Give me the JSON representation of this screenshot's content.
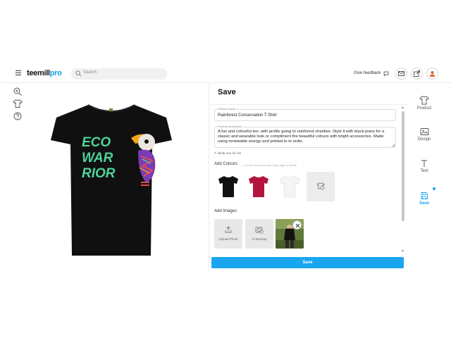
{
  "header": {
    "logo_main": "teemill",
    "logo_pro": "pro",
    "search_placeholder": "Search",
    "feedback_label": "Give feedback",
    "icons": [
      "menu-icon",
      "search-icon",
      "feedback-icon",
      "mail-icon",
      "share-icon",
      "account-icon"
    ]
  },
  "toolrail": {
    "icons": [
      "zoom-in-icon",
      "tshirt-outline-icon",
      "help-icon"
    ]
  },
  "design": {
    "print_lines": [
      "ECO",
      "WAR",
      "RIOR"
    ],
    "shirt_color": "#101010",
    "text_color": "#4fd39a"
  },
  "panel": {
    "title": "Save",
    "product_name": {
      "label": "Product name",
      "value": "Rainforest Conservation T-Shirt"
    },
    "product_description": {
      "label": "Product description",
      "lines": [
        "A fun and colourful tee, with profits going to rainforest charities. Style it with black jeans for a",
        "classic and wearable look or compliment the beautiful colours with bright accessories. Made",
        "using renewable energy and printed to to order."
      ]
    },
    "write_link": "Write one for me",
    "colours": {
      "label": "Add Colours",
      "hint": "— to sort, first is priority. Drag right to delete",
      "swatches": [
        "#111111",
        "#b3153f",
        "#f4f4f4"
      ]
    },
    "images": {
      "label": "Add Images",
      "upload_label": "Upload Photo",
      "mockup_label": "AI Mockup"
    },
    "save_label": "Save"
  },
  "siderail": {
    "items": [
      {
        "label": "Product",
        "icon": "tshirt-icon"
      },
      {
        "label": "Design",
        "icon": "image-icon"
      },
      {
        "label": "Text",
        "icon": "text-icon"
      },
      {
        "label": "Save",
        "icon": "save-icon",
        "active": true
      }
    ]
  },
  "colors": {
    "accent": "#1aa6ef"
  }
}
